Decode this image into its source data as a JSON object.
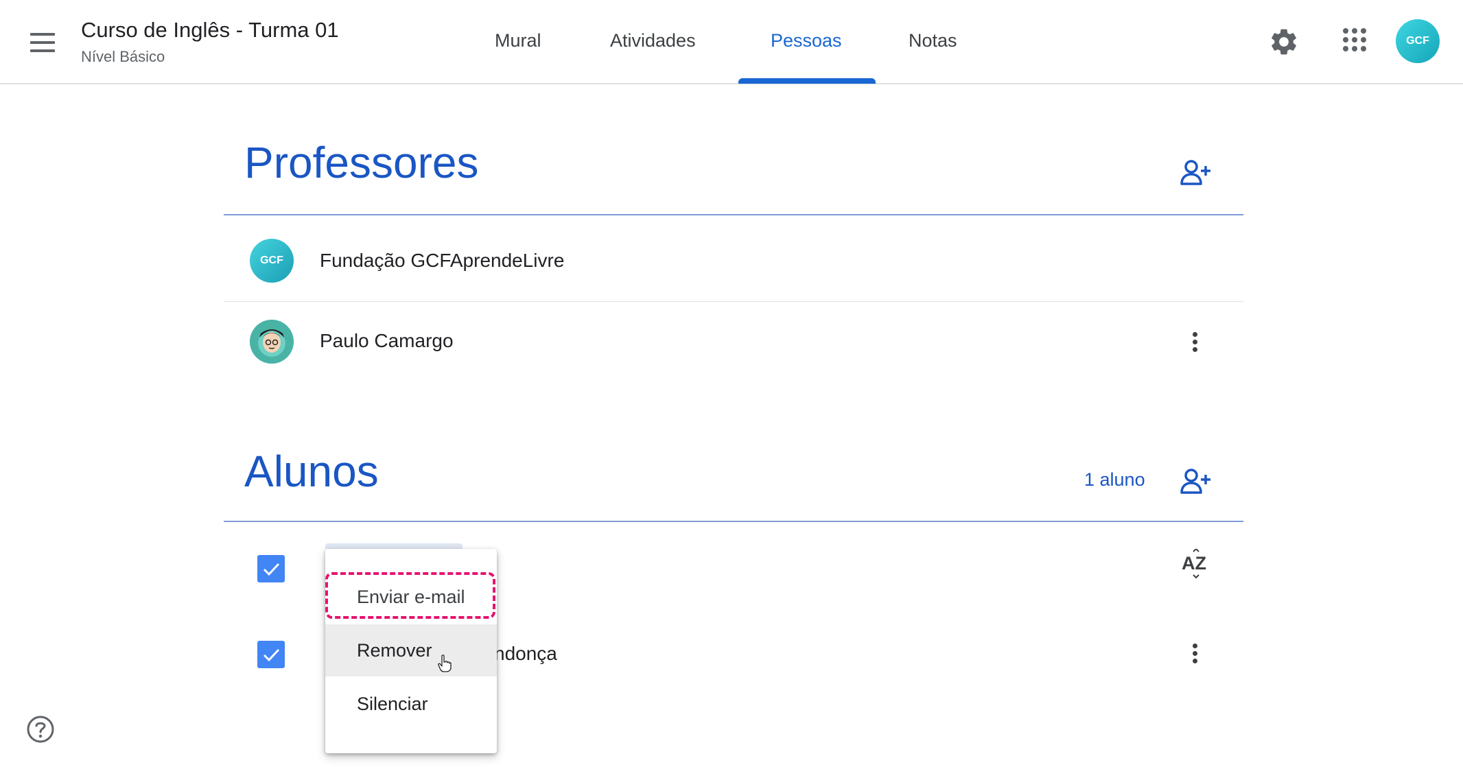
{
  "header": {
    "title": "Curso de Inglês - Turma 01",
    "subtitle": "Nível Básico",
    "tabs": [
      {
        "label": "Mural"
      },
      {
        "label": "Atividades"
      },
      {
        "label": "Pessoas",
        "active": true
      },
      {
        "label": "Notas"
      }
    ],
    "avatar_text": "GCF",
    "accent_color": "#1967d2"
  },
  "teachers": {
    "title": "Professores",
    "add_icon": "add-person-icon",
    "people": [
      {
        "name": "Fundação GCFAprendeLivre",
        "avatar_text": "GCF"
      },
      {
        "name": "Paulo Camargo"
      }
    ]
  },
  "students": {
    "title": "Alunos",
    "count_label": "1 aluno",
    "add_icon": "add-person-icon",
    "sort_icon": "sort-az-icon",
    "student_name_visible": "ndonça"
  },
  "context_menu": {
    "items": [
      {
        "label": "Enviar e-mail"
      },
      {
        "label": "Remover"
      },
      {
        "label": "Silenciar"
      }
    ]
  },
  "icons": {
    "menu": "hamburger-icon",
    "settings": "gear-icon",
    "apps": "apps-grid-icon",
    "help": "help-icon",
    "checkbox": "checkbox-checked-icon",
    "cursor": "hand-pointer-icon"
  },
  "colors": {
    "heading_blue": "#1a56c4",
    "checkbox_blue": "#4285f4",
    "highlight_pink": "#e6136f"
  }
}
